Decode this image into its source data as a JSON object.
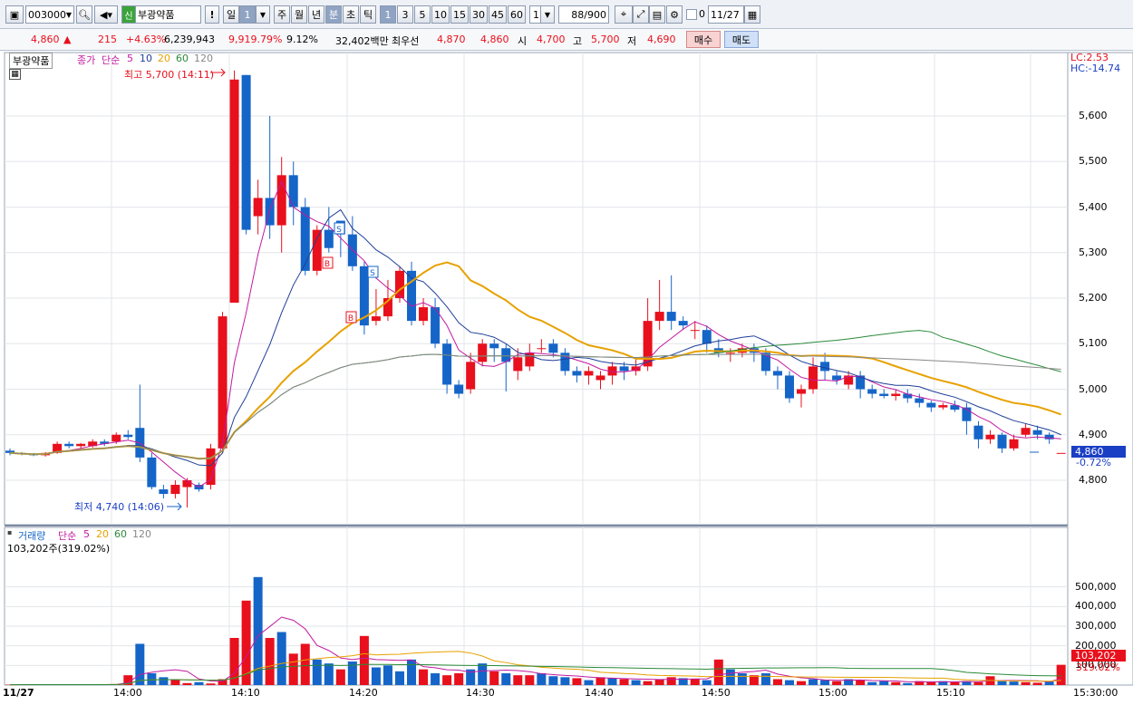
{
  "toolbar": {
    "code": "003000",
    "stock_name": "부광약품",
    "credit_badge": "신",
    "warning_label": "!",
    "period_day": "일",
    "period_value": "1",
    "period_week": "주",
    "period_month": "월",
    "period_year": "년",
    "period_minute": "분",
    "period_second": "초",
    "period_tick": "틱",
    "intervals": [
      "1",
      "3",
      "5",
      "10",
      "15",
      "30",
      "45",
      "60"
    ],
    "interval_input": "1",
    "count_value": "88",
    "count_total": "/900",
    "checkbox_label": "0",
    "date_value": "11/27"
  },
  "quote": {
    "price": "4,860",
    "arrow": "▲",
    "change": "215",
    "change_pct": "+4.63%",
    "volume": "6,239,943",
    "volume_ratio": "9,919.79%",
    "turnover": "9.12%",
    "amount": "32,402백만",
    "best_label": "최우선",
    "best_ask": "4,870",
    "best_bid": "4,860",
    "open_label": "시",
    "open": "4,700",
    "high_label": "고",
    "high": "5,700",
    "low_label": "저",
    "low": "4,690",
    "buy_label": "매수",
    "sell_label": "매도"
  },
  "price_legend": {
    "name": "부광약품",
    "close_label": "종가",
    "method_label": "단순",
    "ma_labels": [
      "5",
      "10",
      "20",
      "60",
      "120"
    ]
  },
  "price_pane": {
    "lc_label": "LC:2.53",
    "hc_label": "HC:-14.74",
    "high_annotation": "최고 5,700 (14:11)",
    "low_annotation": "최저 4,740 (14:06)",
    "current_price_label": "4,860",
    "current_change_label": "-0.72%",
    "y_ticks": [
      "5,600",
      "5,500",
      "5,400",
      "5,300",
      "5,200",
      "5,100",
      "5,000",
      "4,900",
      "4,800"
    ]
  },
  "volume_legend": {
    "name": "거래량",
    "method_label": "단순",
    "ma_labels": [
      "5",
      "20",
      "60",
      "120"
    ],
    "summary": "103,202주(319.02%)"
  },
  "volume_pane": {
    "y_ticks": [
      "500,000",
      "400,000",
      "300,000",
      "200,000",
      "100,000"
    ],
    "current_volume_label": "103,202",
    "current_pct_label": "319.02%"
  },
  "x_axis": {
    "date_label": "11/27",
    "ticks": [
      "14:00",
      "14:10",
      "14:20",
      "14:30",
      "14:40",
      "14:50",
      "15:00",
      "15:10",
      "15:30:00"
    ]
  },
  "colors": {
    "up": "#e8101c",
    "down": "#1565c8",
    "ma5": "#c21aa0",
    "ma10": "#1f3f99",
    "ma20": "#e8a100",
    "ma60": "#2a8a3a",
    "ma120": "#888888"
  },
  "chart_data": {
    "type": "candlestick",
    "y_range": [
      4740,
      5700
    ],
    "signals": [
      {
        "type": "B",
        "time": "14:18"
      },
      {
        "type": "S",
        "time": "14:19"
      },
      {
        "type": "B",
        "time": "14:20"
      },
      {
        "type": "S",
        "time": "14:21"
      }
    ]
  }
}
